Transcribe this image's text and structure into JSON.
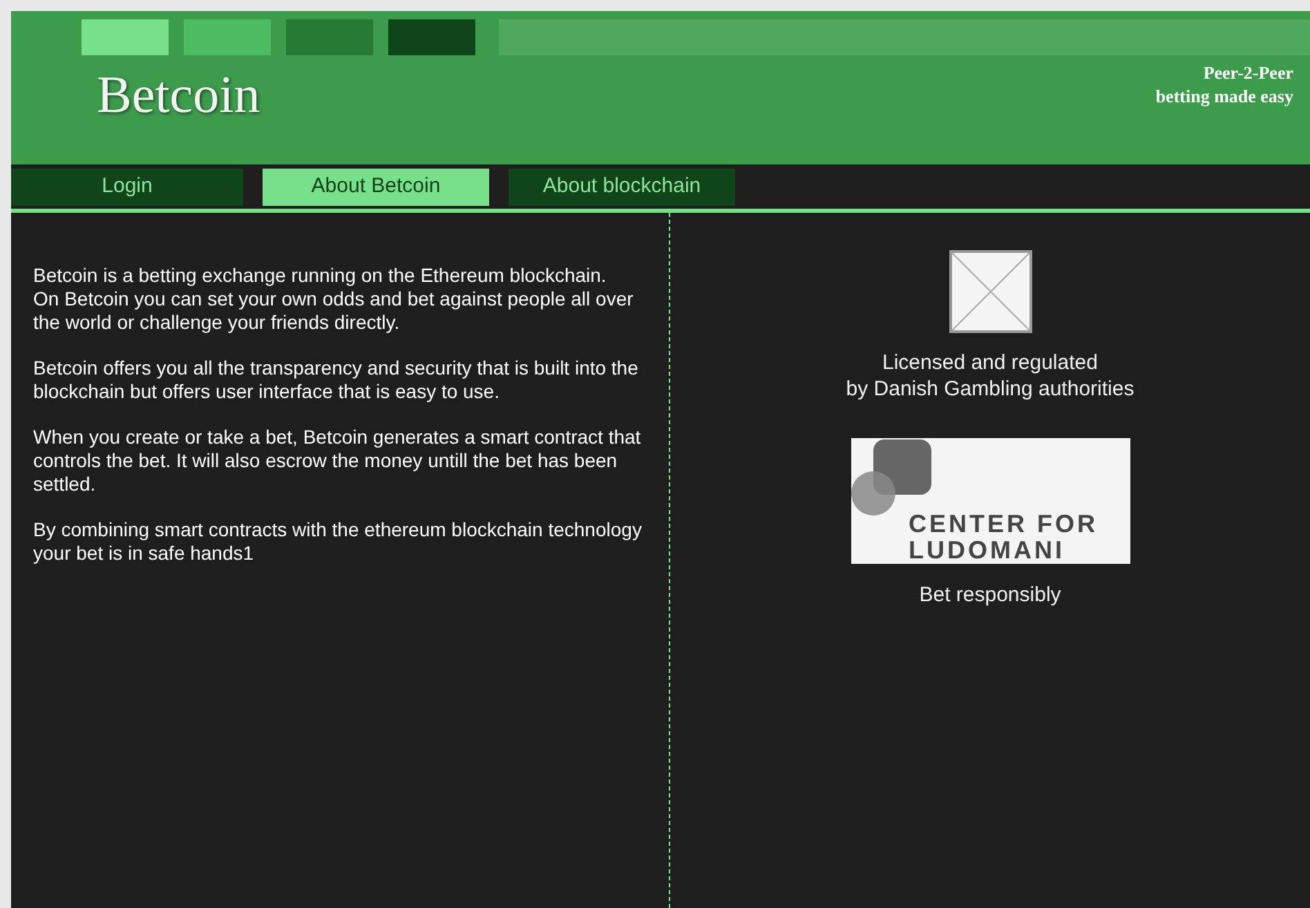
{
  "header": {
    "logo": "Betcoin",
    "tagline": [
      "Peer-2-Peer",
      "betting made easy"
    ],
    "swatches": [
      {
        "color": "#77e08a"
      },
      {
        "color": "#4cbb62"
      },
      {
        "color": "#277a34"
      },
      {
        "color": "#0f4519"
      }
    ]
  },
  "nav": {
    "tabs": [
      {
        "label": "Login",
        "selected": false
      },
      {
        "label": "About Betcoin",
        "selected": true
      },
      {
        "label": "About blockchain",
        "selected": false
      }
    ]
  },
  "about": {
    "paragraphs": [
      "Betcoin is a betting exchange running on the Ethereum blockchain.\nOn Betcoin you can set your own odds and bet against people all over the world or challenge your friends directly.",
      "Betcoin offers you all the transparency and security that is built into the blockchain but offers user interface that is easy to use.",
      "When you create or take a bet, Betcoin generates a smart contract that controls the bet. It will also escrow the money untill the bet has been settled.",
      "By combining smart contracts with the ethereum blockchain technology your bet is in safe hands1"
    ]
  },
  "sidebar": {
    "license_text": [
      "Licensed and regulated",
      "by Danish Gambling authorities"
    ],
    "partner_logo": {
      "line_1": "CENTER FOR",
      "line_2": "LUDOMANI"
    },
    "caption": "Bet responsibly"
  }
}
